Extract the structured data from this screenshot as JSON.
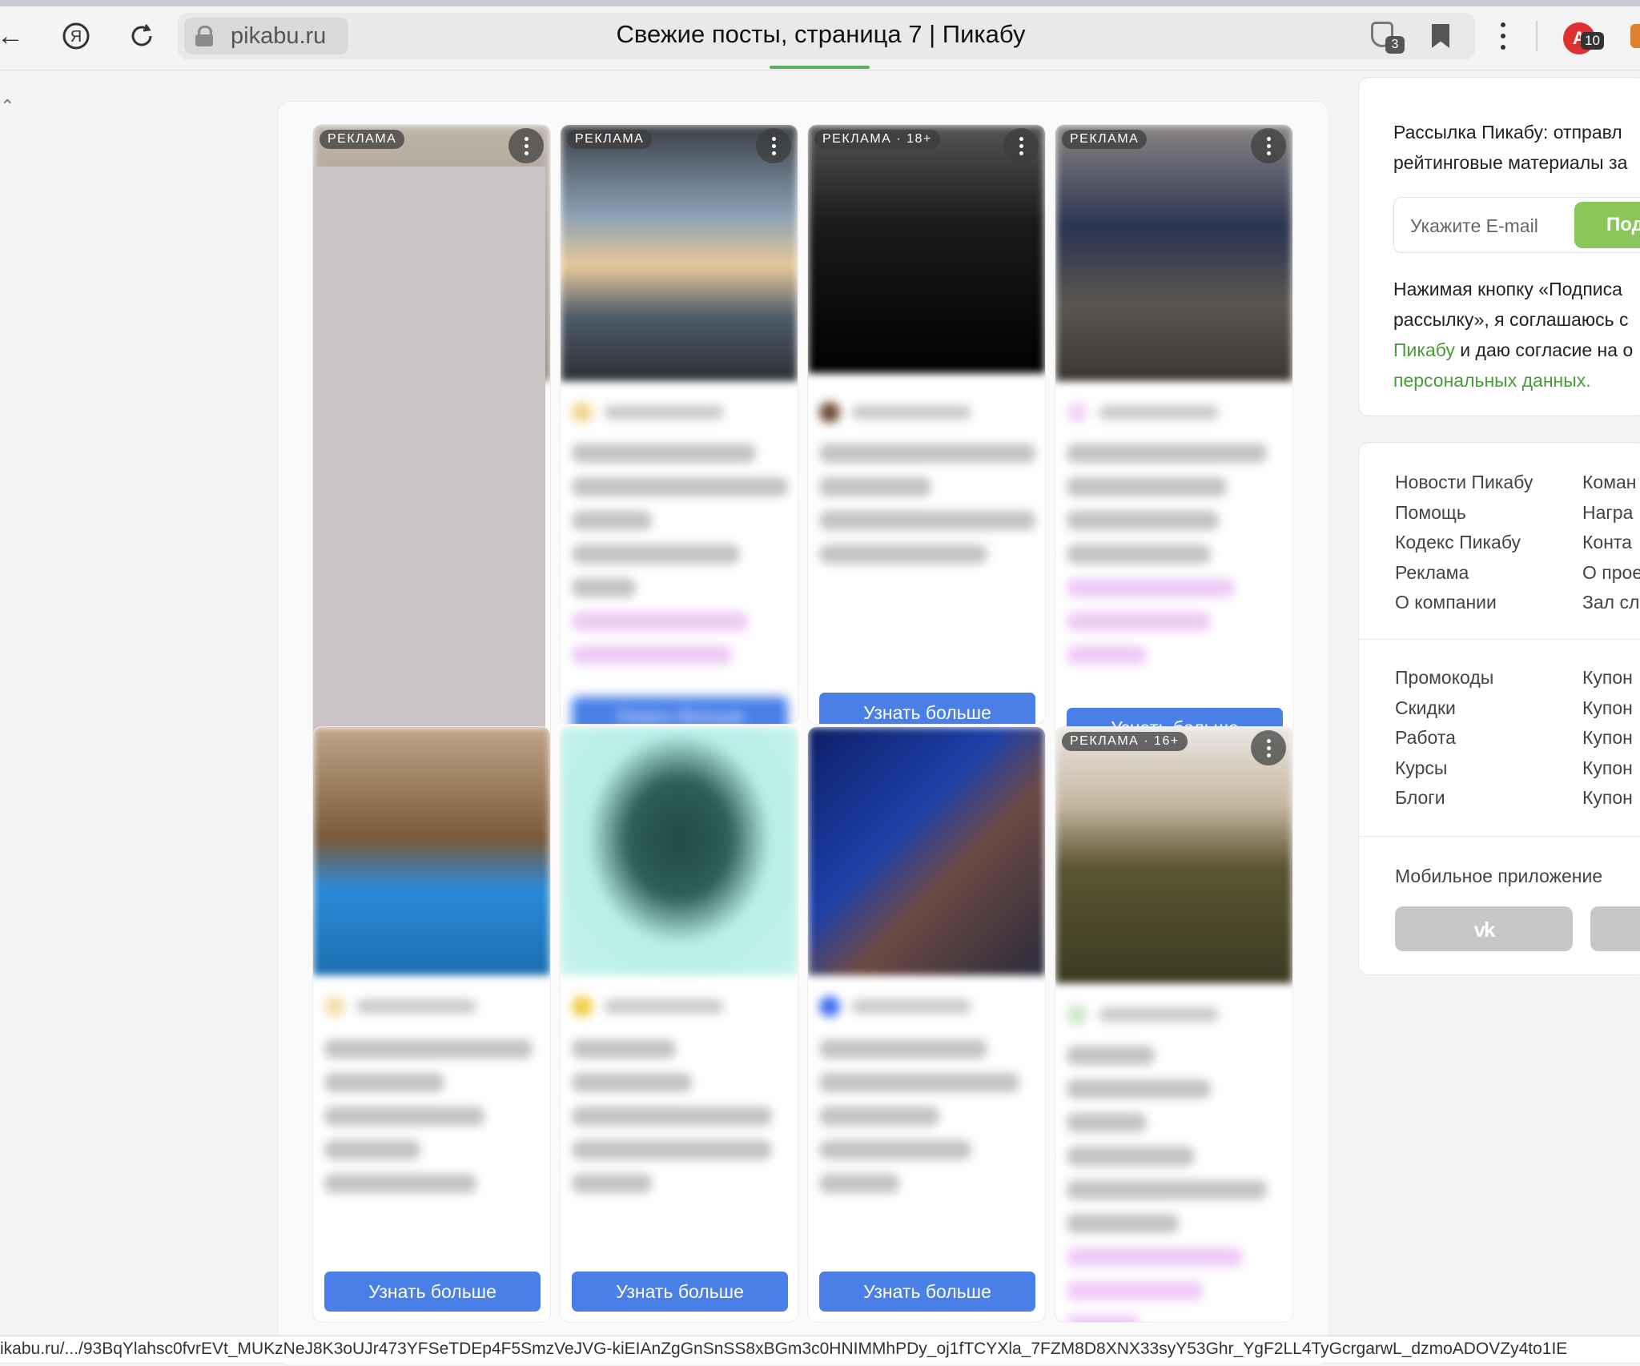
{
  "browser": {
    "domain": "pikabu.ru",
    "tab_title": "Свежие посты, страница 7 | Пикабу",
    "shield_count": "3",
    "adblock_letter": "A",
    "adblock_count": "10",
    "status_url": "ikabu.ru/.../93BqYlahsc0fvrEVt_MUKzNeJ8K3oUJr473YFSeTDEp4F5SmzVeJVG-kiEIAnZgGnSnSS8xBGm3c0HNIMMhPDy_oj1fTCYXla_7FZM8D8XNX33syY53Ghr_YgF2LL4TyGcrgarwL_dzmoADOVZy4to1IE"
  },
  "ads": {
    "label": "РЕКЛАМА",
    "label_18": "РЕКЛАМА · 18+",
    "label_16": "РЕКЛАМА · 16+",
    "cta": "Узнать больше"
  },
  "sidebar": {
    "subscribe_line1": "Рассылка Пикабу: отправл",
    "subscribe_line2": "рейтинговые материалы за",
    "email_placeholder": "Укажите E-mail",
    "subscribe_button": "Под",
    "agree_line1": "Нажимая кнопку «Подписа",
    "agree_line2": "рассылку», я соглашаюсь с",
    "agree_link1": "Пикабу",
    "agree_mid": " и даю согласие на о",
    "agree_link2": "персональных данных.",
    "links_left": [
      "Новости Пикабу",
      "Помощь",
      "Кодекс Пикабу",
      "Реклама",
      "О компании"
    ],
    "links_right": [
      "Коман",
      "Награ",
      "Конта",
      "О прое",
      "Зал сл"
    ],
    "links2_left": [
      "Промокоды",
      "Скидки",
      "Работа",
      "Курсы",
      "Блоги"
    ],
    "links2_right": [
      "Купон",
      "Купон",
      "Купон",
      "Купон",
      "Купон"
    ],
    "mobile_app": "Мобильное приложение",
    "vk_label": "vk"
  },
  "colors": {
    "accent_green": "#8ac65a",
    "link_green": "#4a9b3a",
    "cta_blue": "#4a7fe8"
  }
}
